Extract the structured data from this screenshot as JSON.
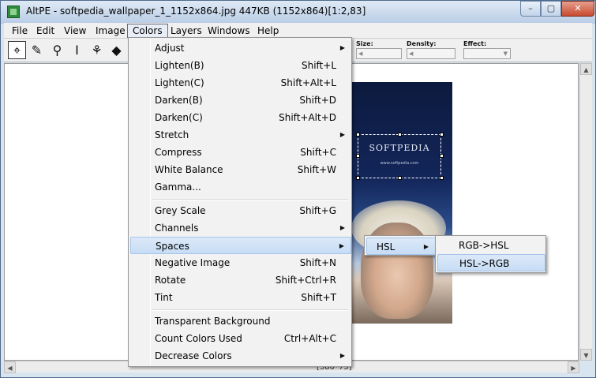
{
  "window": {
    "title": "AltPE - softpedia_wallpaper_1_1152x864.jpg 447KB (1152x864)[1:2,83]",
    "min_glyph": "–",
    "max_glyph": "▢",
    "close_glyph": "✕"
  },
  "menubar": [
    "File",
    "Edit",
    "View",
    "Image",
    "Colors",
    "Layers",
    "Windows",
    "Help"
  ],
  "toolbar": {
    "tools": [
      {
        "name": "crosshair-select-tool-icon",
        "glyph": "⌖"
      },
      {
        "name": "pencil-tool-icon",
        "glyph": "✎"
      },
      {
        "name": "eyedropper-tool-icon",
        "glyph": "⚲"
      },
      {
        "name": "text-cursor-tool-icon",
        "glyph": "I"
      },
      {
        "name": "brush-tool-icon",
        "glyph": "⚘"
      },
      {
        "name": "fill-bucket-tool-icon",
        "glyph": "◆"
      }
    ],
    "size_label": "Size:",
    "density_label": "Density:",
    "effect_label": "Effect:"
  },
  "colors_menu": {
    "items": [
      {
        "label": "Adjust",
        "shortcut": "",
        "submenu": true
      },
      {
        "label": "Lighten(B)",
        "shortcut": "Shift+L",
        "submenu": false
      },
      {
        "label": "Lighten(C)",
        "shortcut": "Shift+Alt+L",
        "submenu": false
      },
      {
        "label": "Darken(B)",
        "shortcut": "Shift+D",
        "submenu": false
      },
      {
        "label": "Darken(C)",
        "shortcut": "Shift+Alt+D",
        "submenu": false
      },
      {
        "label": "Stretch",
        "shortcut": "",
        "submenu": true
      },
      {
        "label": "Compress",
        "shortcut": "Shift+C",
        "submenu": false
      },
      {
        "label": "White Balance",
        "shortcut": "Shift+W",
        "submenu": false
      },
      {
        "label": "Gamma...",
        "shortcut": "",
        "submenu": false
      },
      {
        "label": "Grey Scale",
        "shortcut": "Shift+G",
        "submenu": false
      },
      {
        "label": "Channels",
        "shortcut": "",
        "submenu": true
      },
      {
        "label": "Spaces",
        "shortcut": "",
        "submenu": true
      },
      {
        "label": "Negative Image",
        "shortcut": "Shift+N",
        "submenu": false
      },
      {
        "label": "Rotate",
        "shortcut": "Shift+Ctrl+R",
        "submenu": false
      },
      {
        "label": "Tint",
        "shortcut": "Shift+T",
        "submenu": false
      },
      {
        "label": "Transparent Background",
        "shortcut": "",
        "submenu": false
      },
      {
        "label": "Count Colors Used",
        "shortcut": "Ctrl+Alt+C",
        "submenu": false
      },
      {
        "label": "Decrease Colors",
        "shortcut": "",
        "submenu": true
      }
    ]
  },
  "spaces_submenu": {
    "items": [
      {
        "label": "HSL",
        "submenu": true
      }
    ]
  },
  "hsl_submenu": {
    "items": [
      {
        "label": "RGB->HSL"
      },
      {
        "label": "HSL->RGB"
      }
    ]
  },
  "image": {
    "logo_text": "SOFTPEDIA",
    "url_text": "www.softpedia.com"
  },
  "status": {
    "coord": "[380*75]"
  },
  "scroll_glyphs": {
    "up": "▲",
    "down": "▼",
    "left": "◀",
    "right": "▶"
  }
}
